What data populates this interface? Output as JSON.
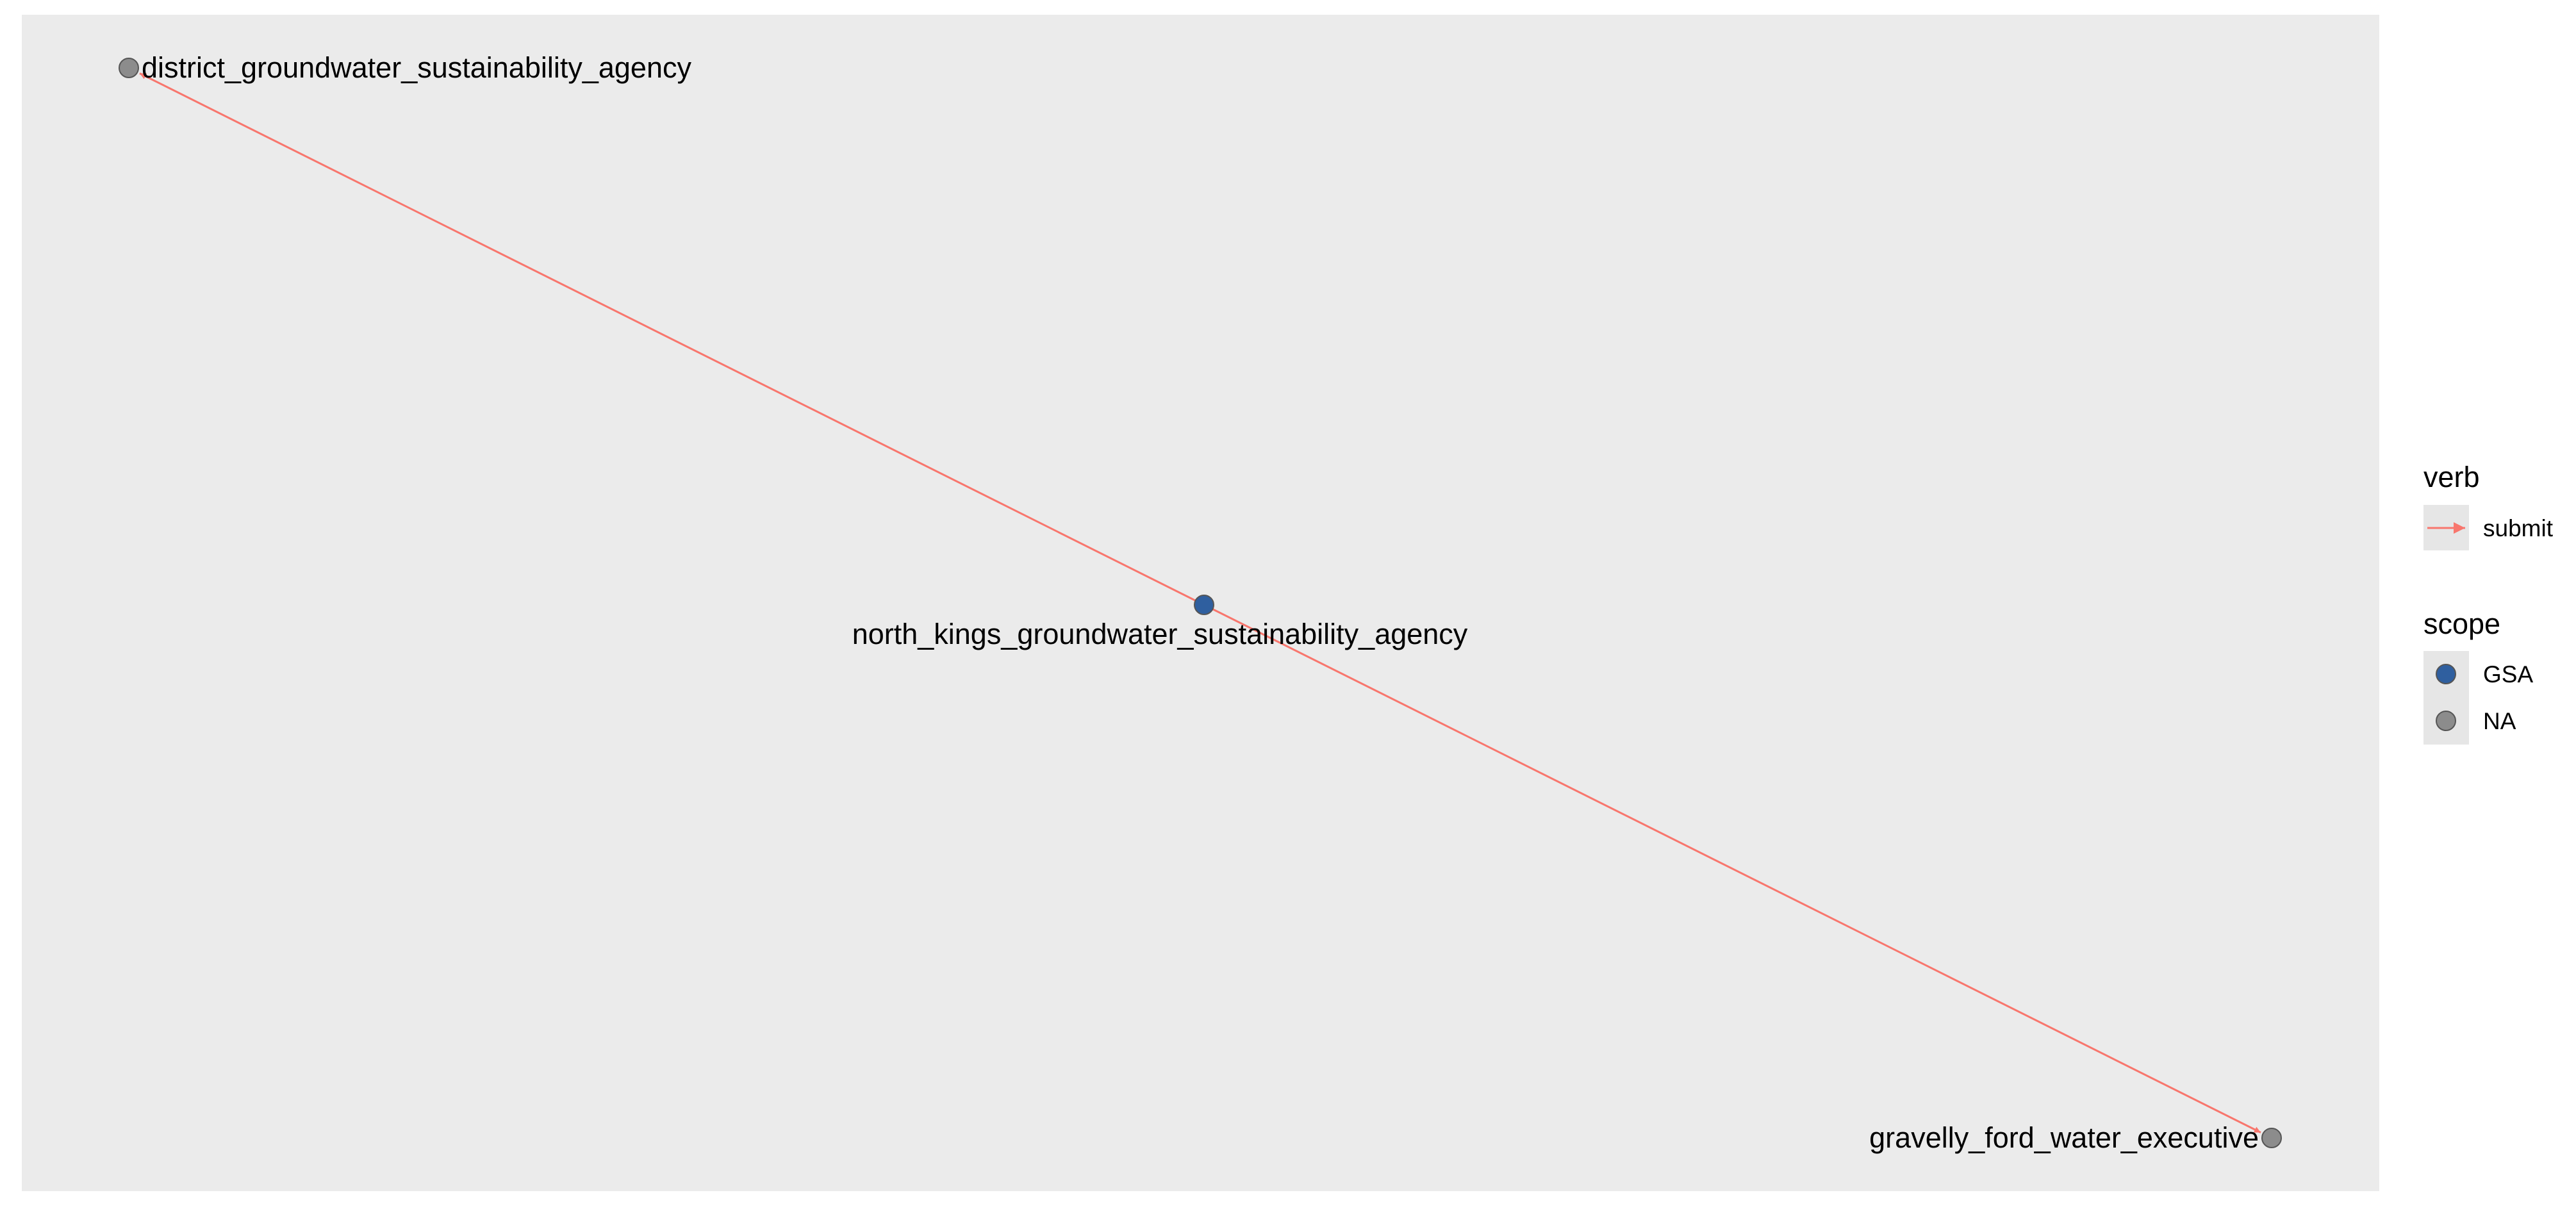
{
  "colors": {
    "panel_background": "#EBEBEB",
    "edge": "#F8766D",
    "legend_key_background": "#E6E6E6",
    "node_outline": "#555555"
  },
  "nodes": [
    {
      "id": "district",
      "label": "district_groundwater_sustainability_agency",
      "scope": "NA",
      "color": "#8C8C8C"
    },
    {
      "id": "north_kings",
      "label": "north_kings_groundwater_sustainability_agency",
      "scope": "GSA",
      "color": "#2F5F9F"
    },
    {
      "id": "gravelly",
      "label": "gravelly_ford_water_executive",
      "scope": "NA",
      "color": "#8C8C8C"
    }
  ],
  "edges": [
    {
      "from": "north_kings",
      "to": "district",
      "verb": "submit"
    },
    {
      "from": "north_kings",
      "to": "gravelly",
      "verb": "submit"
    }
  ],
  "legend": {
    "verb": {
      "title": "verb",
      "items": [
        {
          "label": "submit",
          "color": "#F8766D"
        }
      ]
    },
    "scope": {
      "title": "scope",
      "items": [
        {
          "label": "GSA",
          "color": "#2F5F9F"
        },
        {
          "label": "NA",
          "color": "#8C8C8C"
        }
      ]
    }
  }
}
